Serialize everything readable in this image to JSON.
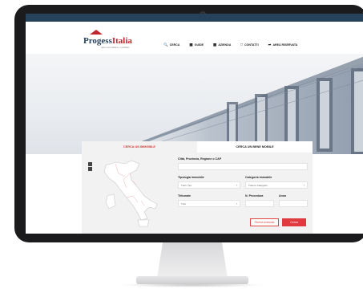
{
  "header": {
    "logo_primary": "Progess",
    "logo_accent": "Italia",
    "logo_tagline": "aste immobiliari e mobiliari",
    "nav": [
      {
        "label": "Cerca",
        "icon": "search-icon"
      },
      {
        "label": "Guide",
        "icon": "guide-icon"
      },
      {
        "label": "Azienda",
        "icon": "building-icon"
      },
      {
        "label": "Contatti",
        "icon": "contact-icon"
      },
      {
        "label": "Area riservata",
        "icon": "login-icon"
      }
    ]
  },
  "search": {
    "tab_active": "Cerca un immobile",
    "tab_inactive": "Cerca un bene mobile",
    "location_label": "Città, Provincia, Regione o CAP",
    "location_value": "",
    "tipologia_label": "Tipologia immobile",
    "tipologia_value": "Tutti i Tipi",
    "categoria_label": "Categoria immobile",
    "categoria_value": "Tutte le Categorie",
    "tribunale_label": "Tribunale",
    "tribunale_value": "Tutti",
    "procedura_label": "N. Procedura",
    "procedura_value": "",
    "anno_label": "Anno",
    "anno_value": "",
    "advanced_button": "Ricerca Avanzata",
    "search_button": "Cerca"
  },
  "colors": {
    "brand_dark": "#26425a",
    "brand_red": "#e0393f"
  }
}
